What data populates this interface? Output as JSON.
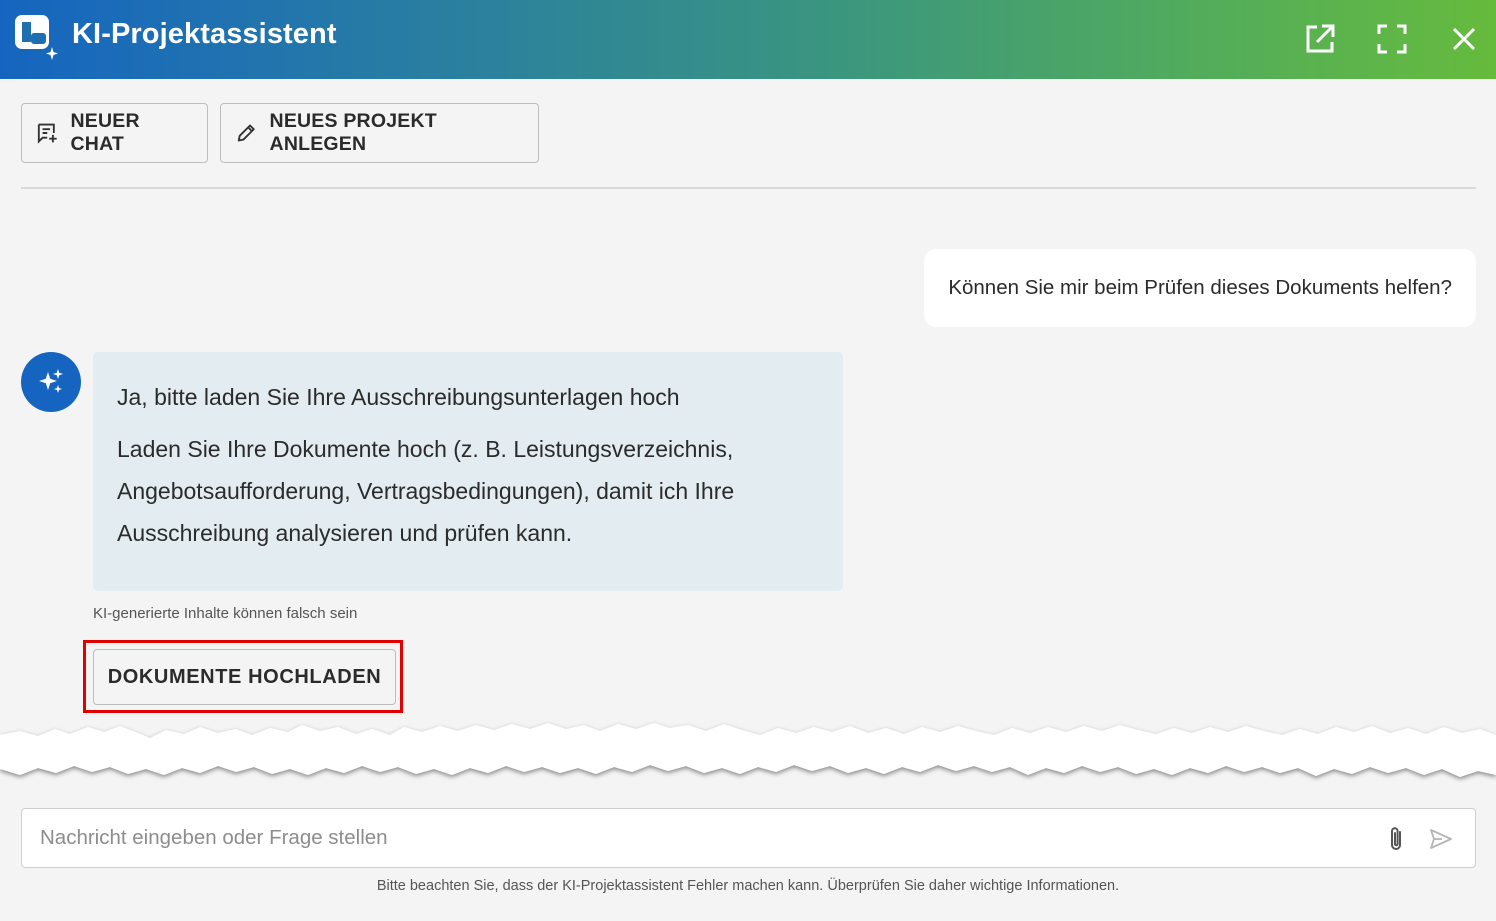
{
  "header": {
    "title": "KI-Projektassistent",
    "actions": [
      {
        "icon": "open-in-new-icon"
      },
      {
        "icon": "fullscreen-icon"
      },
      {
        "icon": "close-icon"
      }
    ]
  },
  "toolbar": {
    "new_chat_label": "NEUER CHAT",
    "new_project_label": "NEUES PROJEKT ANLEGEN"
  },
  "chat": {
    "user_message": "Können Sie mir beim Prüfen dieses Dokuments helfen?",
    "ai_message": {
      "headline": "Ja, bitte laden Sie Ihre Ausschreibungsunterlagen hoch",
      "body_line1": "Laden Sie Ihre Dokumente hoch (z. B. Leistungsverzeichnis,",
      "body_line2": "Angebotsaufforderung, Vertragsbedingungen), damit ich Ihre",
      "body_line3": "Ausschreibung analysieren und prüfen kann."
    },
    "ai_disclaimer": "KI-generierte Inhalte können falsch sein",
    "upload_button_label": "DOKUMENTE HOCHLADEN"
  },
  "composer": {
    "placeholder": "Nachricht eingeben oder Frage stellen",
    "value": ""
  },
  "footer": {
    "note": "Bitte beachten Sie, dass der KI-Projektassistent Fehler machen kann. Überprüfen Sie daher wichtige Informationen."
  },
  "colors": {
    "header_gradient_start": "#1565c0",
    "header_gradient_end": "#66bb3c",
    "ai_bubble_bg": "#e3ecf0",
    "avatar_bg": "#1565c0",
    "highlight_frame": "#e00000"
  }
}
